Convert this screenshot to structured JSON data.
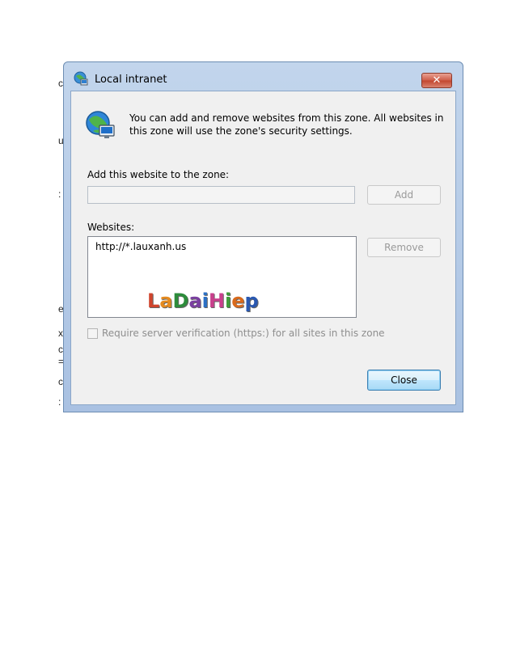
{
  "dialog": {
    "title": "Local intranet",
    "close_glyph": "✕",
    "intro_text": "You can add and remove websites from this zone. All websites in this zone will use the zone's security settings.",
    "add_label": "Add this website to the zone:",
    "add_input_value": "",
    "add_button": "Add",
    "websites_label": "Websites:",
    "websites": [
      "http://*.lauxanh.us"
    ],
    "remove_button": "Remove",
    "require_https_label": "Require server verification (https:) for all sites in this zone",
    "require_https_checked": false,
    "close_button": "Close"
  },
  "watermark": {
    "letters": [
      "L",
      "a",
      "D",
      "a",
      "i",
      "H",
      "i",
      "e",
      "p"
    ]
  },
  "icons": {
    "title_icon": "intranet-globe-icon",
    "zone_icon": "globe-monitor-icon"
  },
  "colors": {
    "title_gradient_top": "#c2d5ec",
    "close_button_red": "#c2452e",
    "default_button_blue": "#3c7fb1"
  }
}
